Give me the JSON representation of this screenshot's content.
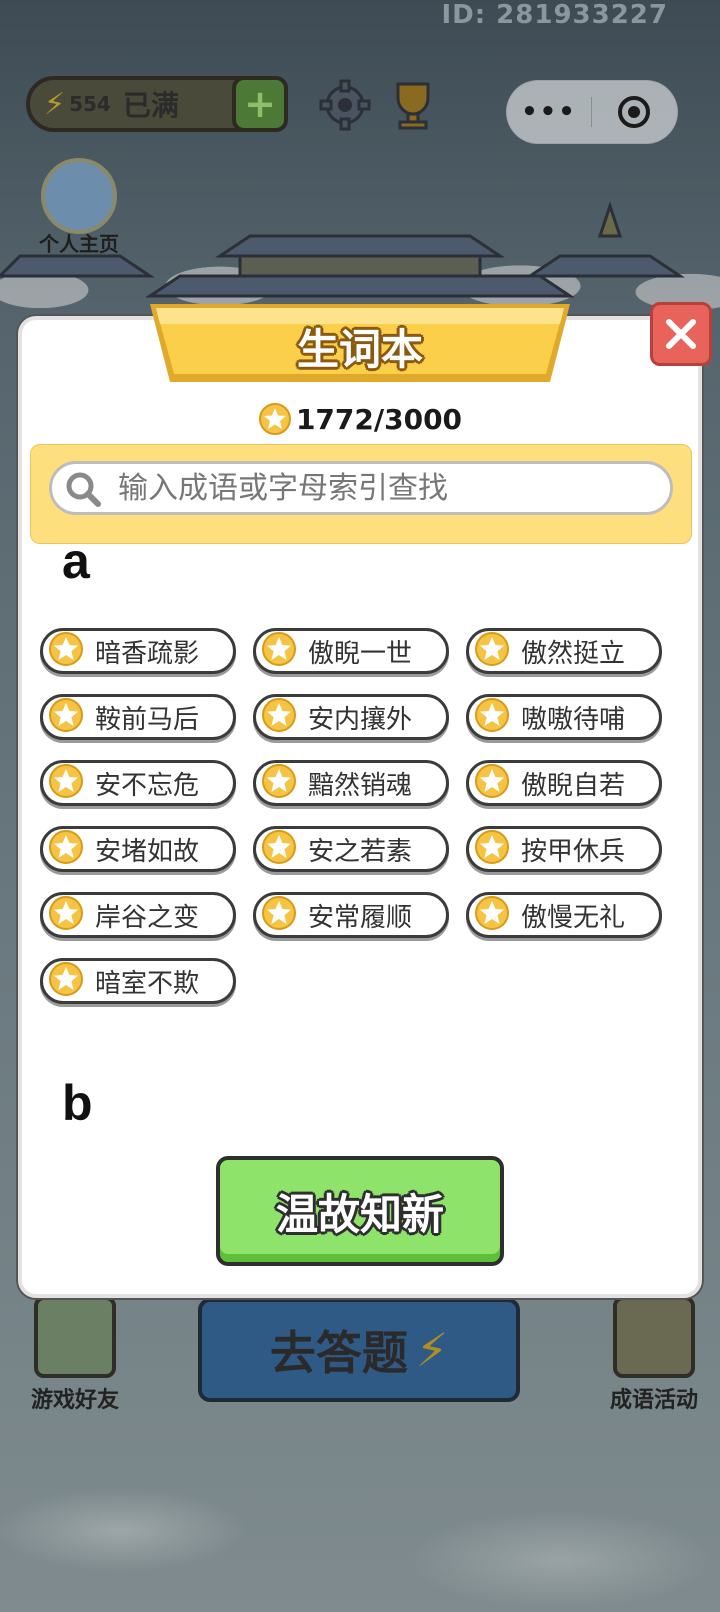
{
  "header": {
    "user_id": "ID: 281933227",
    "energy_count": "554",
    "energy_status": "已满",
    "add_energy": "+",
    "profile_label": "个人主页"
  },
  "modal": {
    "title": "生词本",
    "progress": "1772/3000",
    "search_placeholder": "输入成语或字母索引查找",
    "sections": [
      {
        "letter": "a",
        "idioms": [
          "暗香疏影",
          "傲睨一世",
          "傲然挺立",
          "鞍前马后",
          "安内攘外",
          "嗷嗷待哺",
          "安不忘危",
          "黯然销魂",
          "傲睨自若",
          "安堵如故",
          "安之若素",
          "按甲休兵",
          "岸谷之变",
          "安常履顺",
          "傲慢无礼",
          "暗室不欺"
        ]
      },
      {
        "letter": "b",
        "idioms": []
      }
    ],
    "review_button": "温故知新"
  },
  "bottom": {
    "friends_label": "游戏好友",
    "go_answer_label": "去答题",
    "activity_label": "成语活动"
  },
  "colors": {
    "ribbon_yellow": "#fccf4a",
    "search_panel": "#fde07d",
    "review_green": "#8ee36b",
    "close_red": "#e8645a",
    "star_gold": "#f6c445"
  }
}
